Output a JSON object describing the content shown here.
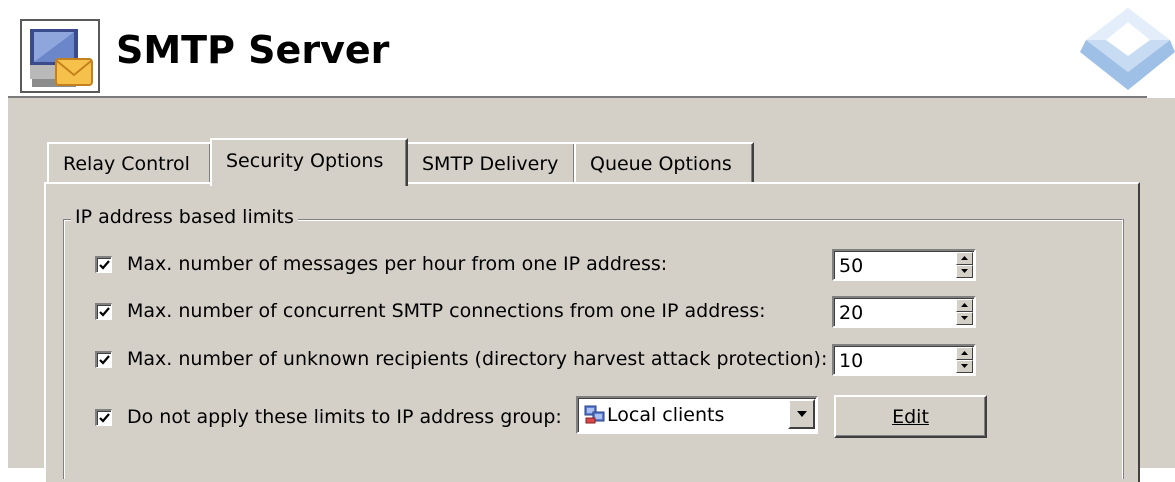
{
  "header": {
    "title": "SMTP Server",
    "app_icon": "mail-server-icon",
    "brand_logo": "diamond-logo-icon"
  },
  "tabs": [
    {
      "label": "Relay Control",
      "active": false
    },
    {
      "label": "Security Options",
      "active": true
    },
    {
      "label": "SMTP Delivery",
      "active": false
    },
    {
      "label": "Queue Options",
      "active": false
    }
  ],
  "group": {
    "legend": "IP address based limits",
    "limits": [
      {
        "label": "Max. number of messages per hour from one IP address:",
        "checked": true,
        "value": "50"
      },
      {
        "label": "Max. number of concurrent SMTP connections from one IP address:",
        "checked": true,
        "value": "20"
      },
      {
        "label": "Max. number of unknown recipients (directory harvest attack protection):",
        "checked": true,
        "value": "10"
      }
    ],
    "exclude": {
      "label": "Do not apply these limits to IP address group:",
      "checked": true,
      "selected_group": "Local clients",
      "group_icon": "local-clients-icon",
      "edit_label": "Edit"
    }
  },
  "colors": {
    "face": "#d4d0c8",
    "shadow": "#808080",
    "dark_shadow": "#404040",
    "highlight": "#ffffff",
    "logo_blue": "#bcd4ee"
  }
}
